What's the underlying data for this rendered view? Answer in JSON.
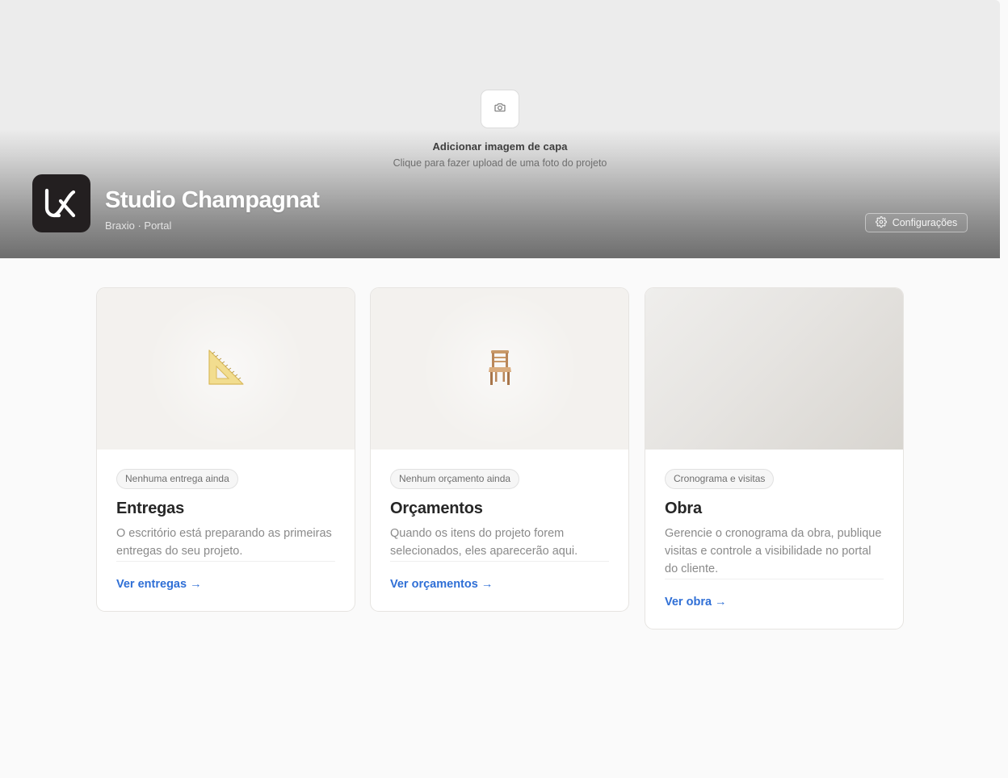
{
  "hero": {
    "cover_upload": {
      "title": "Adicionar imagem de capa",
      "subtitle": "Clique para fazer upload de uma foto do projeto",
      "icon": "camera-icon"
    },
    "logo": {
      "icon": "braxio-logo",
      "color": "#231f20"
    },
    "project_title": "Studio Champagnat",
    "breadcrumb": "Braxio · Portal",
    "settings_button": {
      "label": "Configurações",
      "icon": "gear-icon"
    }
  },
  "cards": [
    {
      "badge": "Nenhuma entrega ainda",
      "title": "Entregas",
      "description": "O escritório está preparando as primeiras entregas do seu projeto.",
      "link": "Ver entregas →",
      "icon": "set-square-icon"
    },
    {
      "badge": "Nenhum orçamento ainda",
      "title": "Orçamentos",
      "description": "Quando os itens do projeto forem selecionados, eles aparecerão aqui.",
      "link": "Ver orçamentos →",
      "icon": "chair-icon"
    },
    {
      "badge": "Cronograma e visitas",
      "title": "Obra",
      "description": "Gerencie o cronograma da obra, publique visitas e controle a visibilidade no portal do cliente.",
      "link": "Ver obra →",
      "icon": ""
    }
  ],
  "colors": {
    "accent_link": "#2f6fd6",
    "page_bg": "#fafafa",
    "card_border": "#e6e4e1"
  }
}
